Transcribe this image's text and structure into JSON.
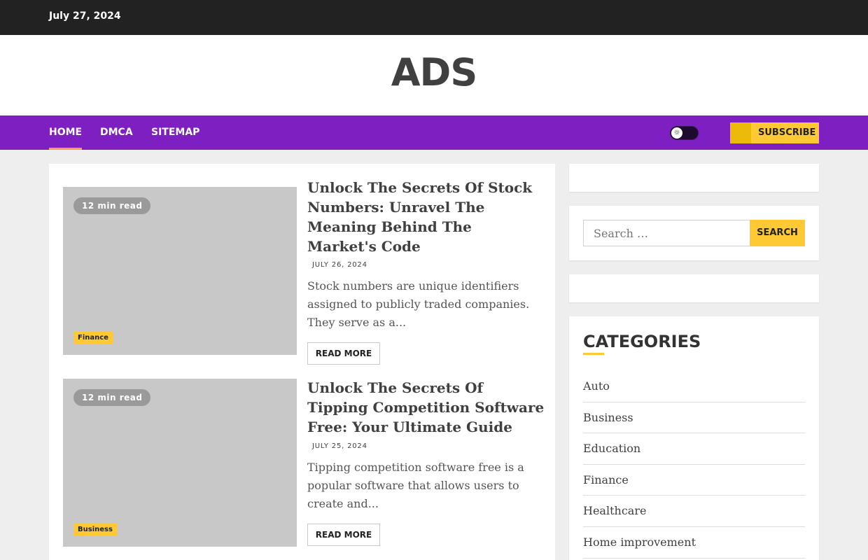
{
  "topbar": {
    "date": "July 27, 2024"
  },
  "header": {
    "site_title": "ADS"
  },
  "nav": {
    "items": [
      {
        "label": "HOME"
      },
      {
        "label": "DMCA"
      },
      {
        "label": "SITEMAP"
      }
    ],
    "subscribe_label": "SUBSCRIBE",
    "colors": {
      "nav_bg": "#7e1fc2",
      "active_underline": "#ff9a53",
      "accent": "#ffc934"
    }
  },
  "posts": [
    {
      "read_time": "12 min read",
      "category": "Finance",
      "title": "Unlock The Secrets Of Stock Numbers: Unravel The Meaning Behind The Market's Code",
      "date": "JULY 26, 2024",
      "excerpt": "Stock numbers are unique identifiers assigned to publicly traded companies. They serve as a...",
      "read_more": "READ MORE"
    },
    {
      "read_time": "12 min read",
      "category": "Business",
      "title": "Unlock The Secrets Of Tipping Competition Software Free: Your Ultimate Guide",
      "date": "JULY 25, 2024",
      "excerpt": "Tipping competition software free is a popular software that allows users to create and...",
      "read_more": "READ MORE"
    }
  ],
  "sidebar": {
    "search": {
      "placeholder": "Search …",
      "button_label": "SEARCH"
    },
    "categories": {
      "heading": "CATEGORIES",
      "items": [
        "Auto",
        "Business",
        "Education",
        "Finance",
        "Healthcare",
        "Home improvement"
      ]
    }
  }
}
